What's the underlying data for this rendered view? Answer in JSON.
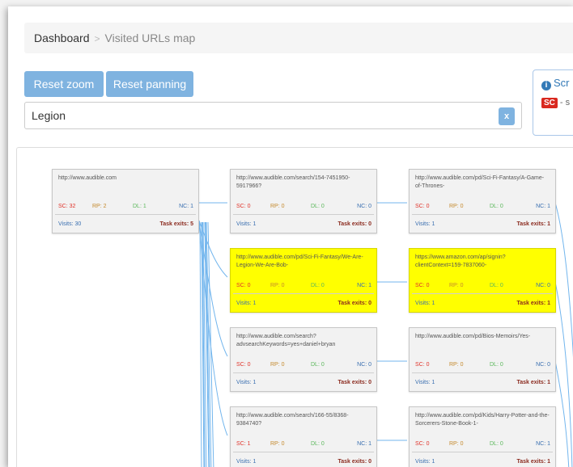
{
  "breadcrumb": {
    "home": "Dashboard",
    "current": "Visited URLs map"
  },
  "toolbar": {
    "reset_zoom": "Reset zoom",
    "reset_panning": "Reset panning"
  },
  "search": {
    "value": "Legion",
    "clear": "x"
  },
  "info_panel": {
    "title": "Scr",
    "badge": "SC",
    "legend_text": "- s"
  },
  "nodes": [
    {
      "url": "http://www.audible.com",
      "sc": "SC: 32",
      "rp": "RP: 2",
      "dl": "DL: 1",
      "nc": "NC: 1",
      "visits": "Visits: 30",
      "exits": "Task exits: 5"
    },
    {
      "url": "http://www.audible.com/search/154-7451950-5917966?",
      "sc": "SC: 0",
      "rp": "RP: 0",
      "dl": "DL: 0",
      "nc": "NC: 0",
      "visits": "Visits: 1",
      "exits": "Task exits: 0"
    },
    {
      "url": "http://www.audible.com/pd/Sci-Fi-Fantasy/A-Game-of-Thrones-",
      "sc": "SC: 0",
      "rp": "RP: 0",
      "dl": "DL: 0",
      "nc": "NC: 1",
      "visits": "Visits: 1",
      "exits": "Task exits: 1"
    },
    {
      "url": "http://www.audible.com/pd/Sci-Fi-Fantasy/We-Are-Legion-We-Are-Bob-",
      "sc": "SC: 0",
      "rp": "RP: 0",
      "dl": "DL: 0",
      "nc": "NC: 1",
      "visits": "Visits: 1",
      "exits": "Task exits: 0"
    },
    {
      "url": "https://www.amazon.com/ap/signin?clientContext=159-7837060-",
      "sc": "SC: 0",
      "rp": "RP: 0",
      "dl": "DL: 0",
      "nc": "NC: 0",
      "visits": "Visits: 1",
      "exits": "Task exits: 1"
    },
    {
      "url": "http://www.audible.com/search?advsearchKeywords=yes+daniel+bryan",
      "sc": "SC: 0",
      "rp": "RP: 0",
      "dl": "DL: 0",
      "nc": "NC: 0",
      "visits": "Visits: 1",
      "exits": "Task exits: 0"
    },
    {
      "url": "http://www.audible.com/pd/Bios-Memoirs/Yes-",
      "sc": "SC: 0",
      "rp": "RP: 0",
      "dl": "DL: 0",
      "nc": "NC: 0",
      "visits": "Visits: 1",
      "exits": "Task exits: 1"
    },
    {
      "url": "http://www.audible.com/search/166-55/8368-9384740?",
      "sc": "SC: 1",
      "rp": "RP: 0",
      "dl": "DL: 0",
      "nc": "NC: 1",
      "visits": "Visits: 1",
      "exits": "Task exits: 0"
    },
    {
      "url": "http://www.audible.com/pd/Kids/Harry-Potter-and-the-Sorcerers-Stone-Book-1-",
      "sc": "SC: 0",
      "rp": "RP: 0",
      "dl": "DL: 0",
      "nc": "NC: 1",
      "visits": "Visits: 1",
      "exits": "Task exits: 1"
    }
  ],
  "colors": {
    "highlight": "#ffff00",
    "button": "#7fb3e0",
    "edge": "#5aa9ea"
  }
}
